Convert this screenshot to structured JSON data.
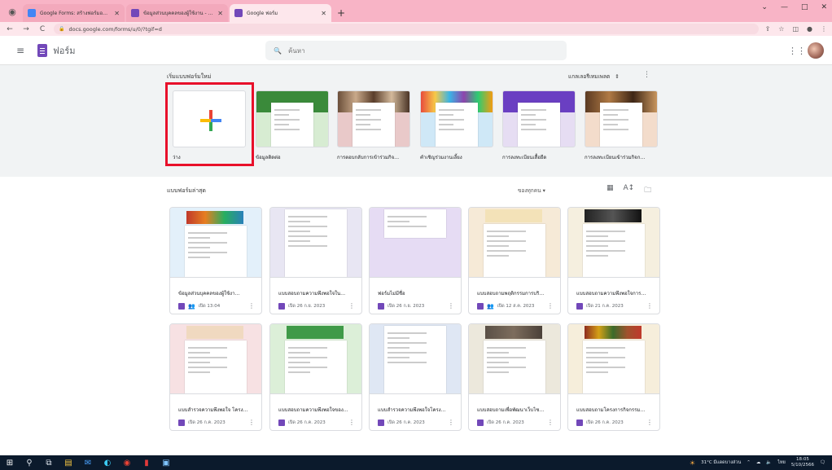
{
  "browser": {
    "tabs": [
      {
        "title": "Google Forms: สร้างฟอร์มออนไลน…",
        "active": false,
        "favicon": "docs"
      },
      {
        "title": "ข้อมูลส่วนบุคคลของผู้ใช้งาน - Goog…",
        "active": false,
        "favicon": "forms"
      },
      {
        "title": "Google ฟอร์ม",
        "active": true,
        "favicon": "forms"
      }
    ],
    "new_tab_label": "+",
    "url": "docs.google.com/forms/u/0/?tgif=d",
    "nav": {
      "back": "←",
      "forward": "→",
      "reload": "C"
    },
    "window_controls": {
      "minimize": "⌄",
      "restore": "—",
      "maximize": "□",
      "close": "✕"
    },
    "toolbar_icons": [
      "share-icon",
      "bookmark-star-icon",
      "extension-icon",
      "profile-icon",
      "menu-dots-icon"
    ]
  },
  "header": {
    "app_title": "ฟอร์ม",
    "search_placeholder": "ค้นหา",
    "menu_glyph": "≡",
    "search_glyph": "🔍",
    "apps_glyph": "⋮⋮"
  },
  "start_section": {
    "label": "เริ่มแบบฟอร์มใหม่",
    "gallery_label": "แกลเลอรีเทมเพลต",
    "gallery_glyph": "⇕",
    "more_glyph": "⋮",
    "templates": [
      {
        "label": "ว่าง",
        "kind": "blank"
      },
      {
        "label": "ข้อมูลติดต่อ",
        "kind": "green"
      },
      {
        "label": "การตอบกลับการเข้าร่วมกิจ…",
        "kind": "photo-party"
      },
      {
        "label": "คำเชิญร่วมงานเลี้ยง",
        "kind": "balloons"
      },
      {
        "label": "การลงทะเบียนเสื้อยืด",
        "kind": "purple"
      },
      {
        "label": "การลงทะเบียนเข้าร่วมกิจก…",
        "kind": "photo-event"
      }
    ]
  },
  "recent": {
    "label": "แบบฟอร์มล่าสุด",
    "owner_filter": "ของทุกคน ▾",
    "view_icons": {
      "grid": "▦",
      "sort": "A↕",
      "folder": "🗀"
    },
    "forms": [
      {
        "title": "ข้อมูลส่วนบุคคลของผู้ใช้งา…",
        "date": "เปิด 13:04",
        "shared": true,
        "thumb": "photo"
      },
      {
        "title": "แบบสอบถามความพึงพอใจใน…",
        "date": "เปิด 26 ก.ย. 2023",
        "shared": false,
        "thumb": "lavender"
      },
      {
        "title": "ฟอร์มไม่มีชื่อ",
        "date": "เปิด 26 ก.ย. 2023",
        "shared": false,
        "thumb": "purple"
      },
      {
        "title": "แบบสอบถามพฤติกรรมการบริ…",
        "date": "เปิด 12 ส.ค. 2023",
        "shared": true,
        "thumb": "clock"
      },
      {
        "title": "แบบสอบถามความพึงพอใจการ…",
        "date": "เปิด 21 ก.ค. 2023",
        "shared": false,
        "thumb": "dark"
      },
      {
        "title": "แบบสำรวจความพึงพอใจ โครง…",
        "date": "เปิด 26 ก.ค. 2023",
        "shared": false,
        "thumb": "pink"
      },
      {
        "title": "แบบสอบถามความพึงพอใจของ…",
        "date": "เปิด 26 ก.ค. 2023",
        "shared": false,
        "thumb": "green"
      },
      {
        "title": "แบบสำรวจความพึงพอใจโครง…",
        "date": "เปิด 26 ก.ค. 2023",
        "shared": false,
        "thumb": "blue"
      },
      {
        "title": "แบบสอบถามเพื่อพัฒนาเว็บไซ…",
        "date": "เปิด 26 ก.ค. 2023",
        "shared": false,
        "thumb": "lights"
      },
      {
        "title": "แบบสอบถามโครงการกิจกรรม…",
        "date": "เปิด 26 ก.ค. 2023",
        "shared": false,
        "thumb": "books"
      }
    ]
  },
  "taskbar": {
    "weather": "31°C มีแดดบางส่วน",
    "lang": "ไทย",
    "time": "18:05",
    "date": "5/10/2566",
    "icons": [
      "start-icon",
      "search-icon",
      "task-view-icon",
      "explorer-icon",
      "mail-icon",
      "edge-icon",
      "chrome-icon",
      "app-icon",
      "photos-icon"
    ]
  }
}
